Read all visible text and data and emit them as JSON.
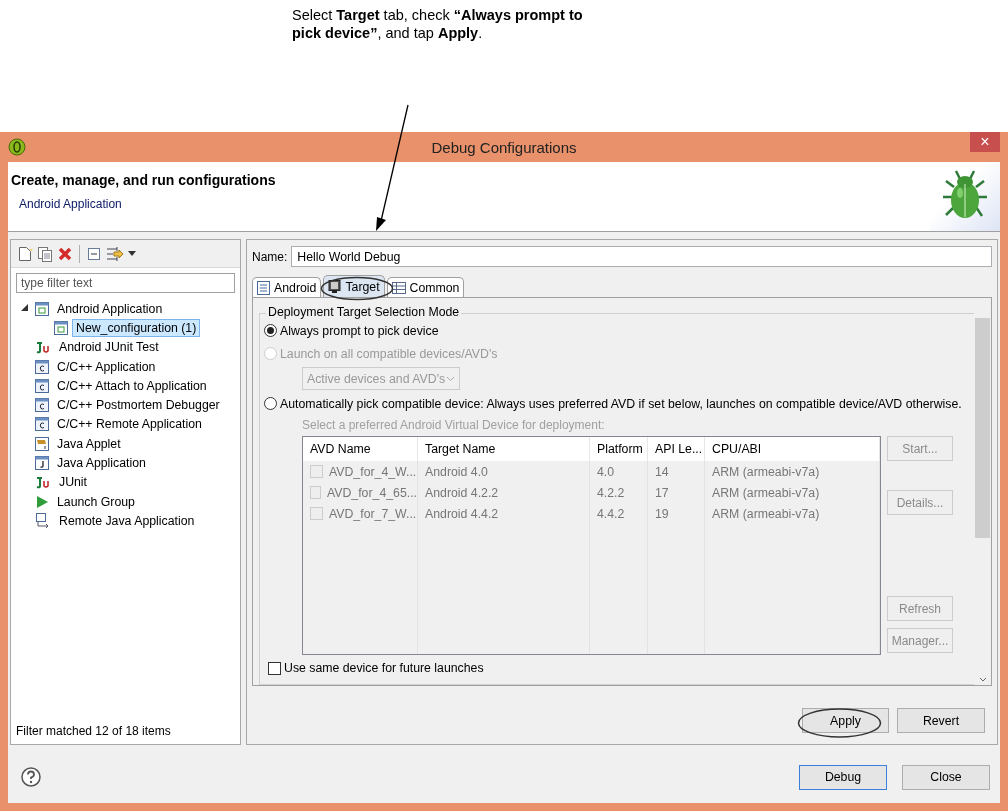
{
  "annotation": {
    "text": "Select **Target** tab, check **“Always prompt to pick device”**, and tap **Apply**."
  },
  "window": {
    "title": "Debug Configurations",
    "close": "×"
  },
  "header": {
    "title": "Create, manage, and run configurations",
    "subtitle": "Android Application"
  },
  "sidebar": {
    "filter_placeholder": "type filter text",
    "tree": [
      {
        "label": "Android Application",
        "kind": "android",
        "expanded": true,
        "selected": false,
        "children": [
          {
            "label": "New_configuration (1)",
            "kind": "android",
            "selected": true
          }
        ]
      },
      {
        "label": "Android JUnit Test",
        "kind": "junit",
        "selected": false
      },
      {
        "label": "C/C++ Application",
        "kind": "cpp",
        "selected": false
      },
      {
        "label": "C/C++ Attach to Application",
        "kind": "cpp",
        "selected": false
      },
      {
        "label": "C/C++ Postmortem Debugger",
        "kind": "cpp",
        "selected": false
      },
      {
        "label": "C/C++ Remote Application",
        "kind": "cpp",
        "selected": false
      },
      {
        "label": "Java Applet",
        "kind": "applet",
        "selected": false
      },
      {
        "label": "Java Application",
        "kind": "java",
        "selected": false
      },
      {
        "label": "JUnit",
        "kind": "junit",
        "selected": false
      },
      {
        "label": "Launch Group",
        "kind": "launch",
        "selected": false
      },
      {
        "label": "Remote Java Application",
        "kind": "remote",
        "selected": false
      }
    ],
    "footer": "Filter matched 12 of 18 items"
  },
  "name_field": {
    "label": "Name:",
    "value": "Hello World Debug"
  },
  "tabs": [
    {
      "label": "Android",
      "selected": false
    },
    {
      "label": "Target",
      "selected": true
    },
    {
      "label": "Common",
      "selected": false
    }
  ],
  "target": {
    "group_title": "Deployment Target Selection Mode",
    "options": [
      {
        "label": "Always prompt to pick device",
        "selected": true,
        "disabled": false
      },
      {
        "label": "Launch on all compatible devices/AVD's",
        "selected": false,
        "disabled": true
      },
      {
        "label": "Automatically pick compatible device: Always uses preferred AVD if set below, launches on compatible device/AVD otherwise.",
        "selected": false,
        "disabled": false
      }
    ],
    "dropdown": {
      "value": "Active devices and AVD's",
      "disabled": true
    },
    "avd_hint": "Select a preferred Android Virtual Device for deployment:",
    "table": {
      "columns": [
        "AVD Name",
        "Target Name",
        "Platform",
        "API Le...",
        "CPU/ABI"
      ],
      "rows": [
        {
          "checked": false,
          "cells": [
            "AVD_for_4_W...",
            "Android 4.0",
            "4.0",
            "14",
            "ARM (armeabi-v7a)"
          ]
        },
        {
          "checked": false,
          "cells": [
            "AVD_for_4_65...",
            "Android 4.2.2",
            "4.2.2",
            "17",
            "ARM (armeabi-v7a)"
          ]
        },
        {
          "checked": false,
          "cells": [
            "AVD_for_7_W...",
            "Android 4.4.2",
            "4.4.2",
            "19",
            "ARM (armeabi-v7a)"
          ]
        }
      ]
    },
    "side_buttons": [
      {
        "label": "Start...",
        "disabled": true
      },
      {
        "label": "Details...",
        "disabled": true
      },
      {
        "label": "Refresh",
        "disabled": true
      },
      {
        "label": "Manager...",
        "disabled": true
      }
    ],
    "same_device": {
      "label": "Use same device for future launches",
      "checked": false
    }
  },
  "apply_buttons": [
    "Apply",
    "Revert"
  ],
  "footer_buttons": [
    {
      "label": "Debug",
      "default": true
    },
    {
      "label": "Close",
      "default": false
    }
  ]
}
